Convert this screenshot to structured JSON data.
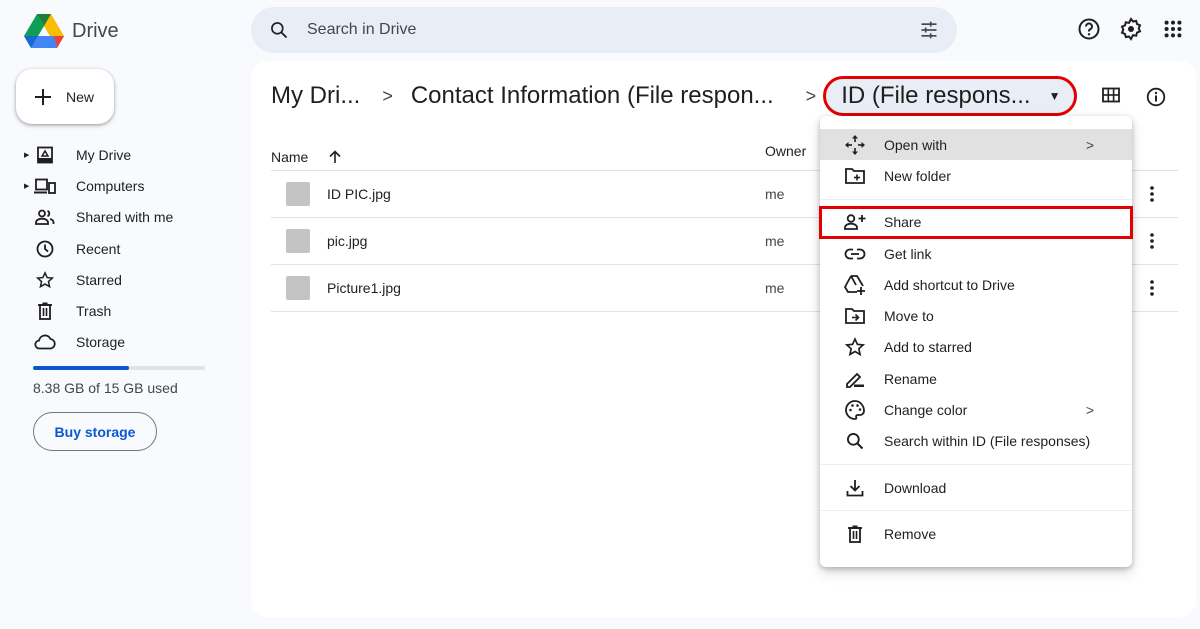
{
  "app": {
    "name": "Drive"
  },
  "search": {
    "placeholder": "Search in Drive"
  },
  "header_icons": [
    "help-icon",
    "settings-icon",
    "apps-icon"
  ],
  "sidebar": {
    "new_label": "New",
    "items": [
      {
        "label": "My Drive",
        "icon": "my-drive-icon",
        "expandable": true
      },
      {
        "label": "Computers",
        "icon": "computers-icon",
        "expandable": true
      },
      {
        "label": "Shared with me",
        "icon": "shared-icon",
        "expandable": false
      },
      {
        "label": "Recent",
        "icon": "clock-icon",
        "expandable": false
      },
      {
        "label": "Starred",
        "icon": "star-icon",
        "expandable": false
      },
      {
        "label": "Trash",
        "icon": "trash-icon",
        "expandable": false
      },
      {
        "label": "Storage",
        "icon": "cloud-icon",
        "expandable": false
      }
    ],
    "storage": {
      "used_text": "8.38 GB of 15 GB used",
      "used_fraction": 0.559
    },
    "buy_storage_label": "Buy storage"
  },
  "breadcrumb": {
    "items": [
      "My Dri...",
      "Contact Information (File respon..."
    ],
    "current": "ID (File respons..."
  },
  "table": {
    "columns": {
      "name": "Name",
      "owner": "Owner"
    },
    "sort": "ascending",
    "rows": [
      {
        "name": "ID PIC.jpg",
        "owner": "me"
      },
      {
        "name": "pic.jpg",
        "owner": "me"
      },
      {
        "name": "Picture1.jpg",
        "owner": "me"
      }
    ]
  },
  "context_menu": {
    "items": [
      {
        "label": "Open with",
        "icon": "open-with-icon",
        "submenu": true
      },
      {
        "label": "New folder",
        "icon": "new-folder-icon"
      },
      {
        "label": "Share",
        "icon": "share-icon"
      },
      {
        "label": "Get link",
        "icon": "link-icon"
      },
      {
        "label": "Add shortcut to Drive",
        "icon": "add-shortcut-icon"
      },
      {
        "label": "Move to",
        "icon": "move-to-icon"
      },
      {
        "label": "Add to starred",
        "icon": "star-icon"
      },
      {
        "label": "Rename",
        "icon": "rename-icon"
      },
      {
        "label": "Change color",
        "icon": "palette-icon",
        "submenu": true
      },
      {
        "label": "Search within ID (File responses)",
        "icon": "search-icon"
      },
      {
        "label": "Download",
        "icon": "download-icon"
      },
      {
        "label": "Remove",
        "icon": "trash-icon"
      }
    ]
  },
  "colors": {
    "accent": "#0b57d0",
    "highlight": "#e30000",
    "search_bg": "#e9eef6"
  }
}
